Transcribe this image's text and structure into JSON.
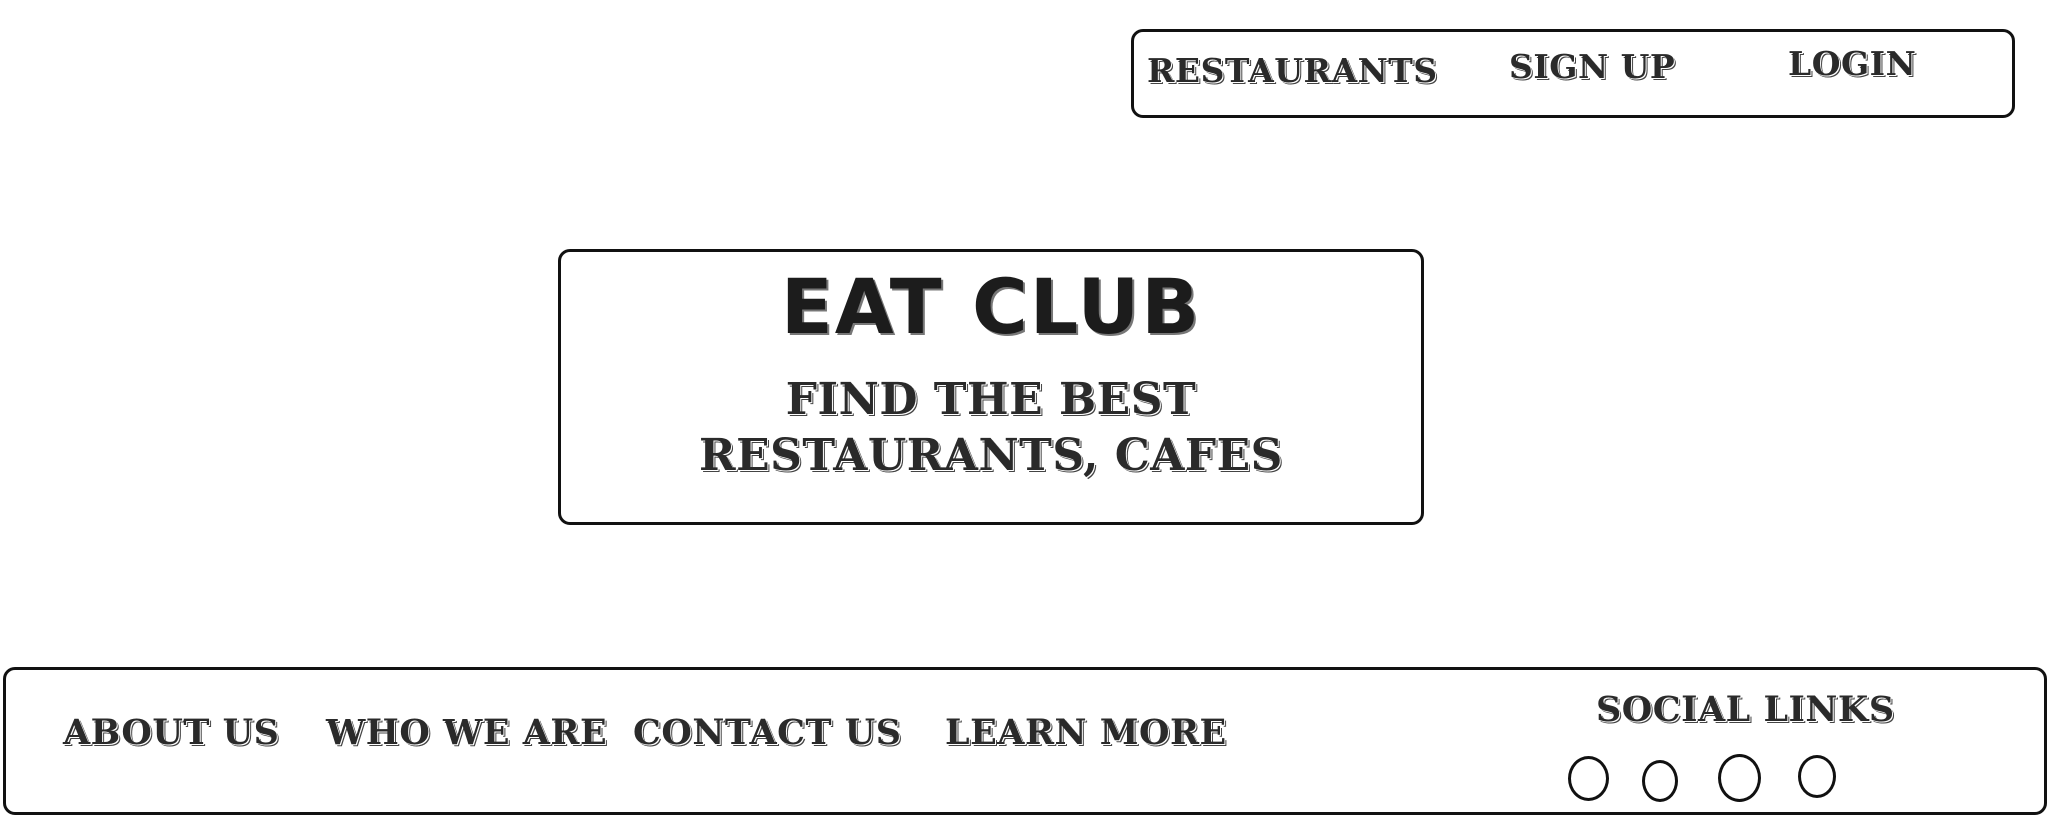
{
  "nav": {
    "restaurants_label": "RESTAURANTS",
    "signup_label": "SIGN UP",
    "login_label": "LOGIN"
  },
  "hero": {
    "title": "EAT CLUB",
    "tagline": "FIND THE BEST RESTAURANTS, CAFES"
  },
  "footer": {
    "links": [
      {
        "label": "ABOUT US"
      },
      {
        "label": "WHO WE ARE"
      },
      {
        "label": "CONTACT US"
      },
      {
        "label": "LEARN MORE"
      }
    ],
    "social": {
      "title": "SOCIAL LINKS",
      "icons": [
        "social-icon-1",
        "social-icon-2",
        "social-icon-3",
        "social-icon-4"
      ]
    }
  }
}
